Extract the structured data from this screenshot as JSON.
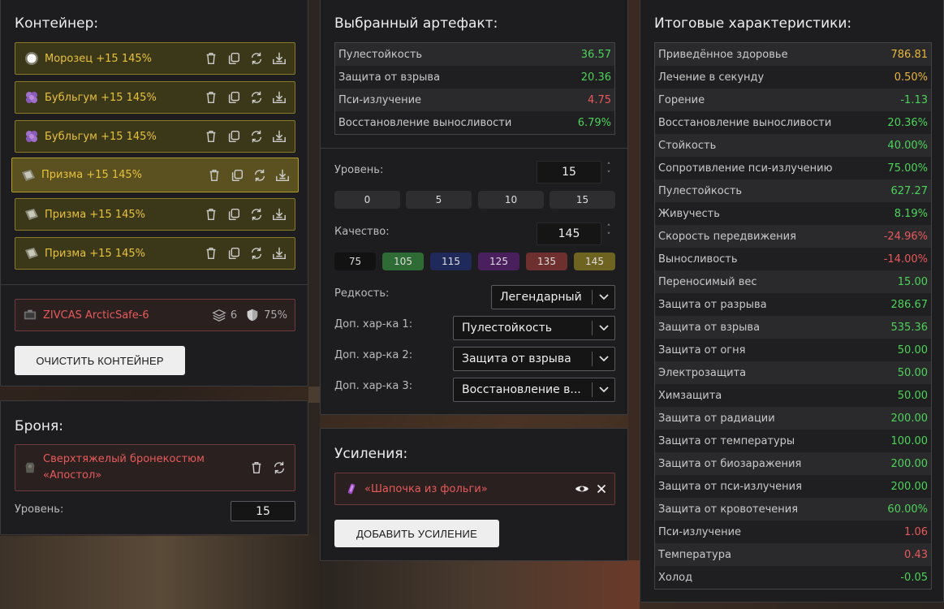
{
  "container": {
    "title": "Контейнер:",
    "items": [
      {
        "label": "Морозец +15 145%",
        "icon": "frost-orb-icon",
        "selected": false
      },
      {
        "label": "Бубльгум +15 145%",
        "icon": "bubblegum-icon",
        "selected": false
      },
      {
        "label": "Бубльгум +15 145%",
        "icon": "bubblegum-icon",
        "selected": false
      },
      {
        "label": "Призма +15 145%",
        "icon": "prism-icon",
        "selected": true
      },
      {
        "label": "Призма +15 145%",
        "icon": "prism-icon",
        "selected": false
      },
      {
        "label": "Призма +15 145%",
        "icon": "prism-icon",
        "selected": false
      }
    ],
    "box": {
      "name": "ZIVCAS ArcticSafe-6",
      "slots": "6",
      "protection": "75%"
    },
    "clear_label": "ОЧИСТИТЬ КОНТЕЙНЕР"
  },
  "armor": {
    "title": "Броня:",
    "name_line1": "Сверхтяжелый бронекостюм",
    "name_line2": "«Апостол»",
    "level_label": "Уровень:",
    "level_value": "15"
  },
  "artifact": {
    "title": "Выбранный артефакт:",
    "stats": [
      {
        "name": "Пулестойкость",
        "value": "36.57",
        "tone": "green"
      },
      {
        "name": "Защита от взрыва",
        "value": "20.36",
        "tone": "green"
      },
      {
        "name": "Пси-излучение",
        "value": "4.75",
        "tone": "red"
      },
      {
        "name": "Восстановление выносливости",
        "value": "6.79%",
        "tone": "green"
      }
    ],
    "level_label": "Уровень:",
    "level_value": "15",
    "level_presets": [
      "0",
      "5",
      "10",
      "15"
    ],
    "quality_label": "Качество:",
    "quality_value": "145",
    "quality_presets": [
      {
        "label": "75",
        "color": "#121212"
      },
      {
        "label": "105",
        "color": "#2f6b34"
      },
      {
        "label": "115",
        "color": "#1f2a5a"
      },
      {
        "label": "125",
        "color": "#4a1f5e"
      },
      {
        "label": "135",
        "color": "#6e2f2f"
      },
      {
        "label": "145",
        "color": "#6e6320"
      }
    ],
    "rarity_label": "Редкость:",
    "rarity_value": "Легендарный",
    "extra1_label": "Доп. хар-ка 1:",
    "extra1_value": "Пулестойкость",
    "extra2_label": "Доп. хар-ка 2:",
    "extra2_value": "Защита от взрыва",
    "extra3_label": "Доп. хар-ка 3:",
    "extra3_value": "Восстановление в..."
  },
  "boosts": {
    "title": "Усиления:",
    "item": "«Шапочка из фольги»",
    "add_label": "ДОБАВИТЬ УСИЛЕНИЕ"
  },
  "totals": {
    "title": "Итоговые характеристики:",
    "rows": [
      {
        "name": "Приведённое здоровье",
        "value": "786.81",
        "tone": "yellow"
      },
      {
        "name": "Лечение в секунду",
        "value": "0.50%",
        "tone": "yellow"
      },
      {
        "name": "Горение",
        "value": "-1.13",
        "tone": "green"
      },
      {
        "name": "Восстановление выносливости",
        "value": "20.36%",
        "tone": "green"
      },
      {
        "name": "Стойкость",
        "value": "40.00%",
        "tone": "green"
      },
      {
        "name": "Сопротивление пси-излучению",
        "value": "75.00%",
        "tone": "green"
      },
      {
        "name": "Пулестойкость",
        "value": "627.27",
        "tone": "green"
      },
      {
        "name": "Живучесть",
        "value": "8.19%",
        "tone": "green"
      },
      {
        "name": "Скорость передвижения",
        "value": "-24.96%",
        "tone": "red"
      },
      {
        "name": "Выносливость",
        "value": "-14.00%",
        "tone": "red"
      },
      {
        "name": "Переносимый вес",
        "value": "15.00",
        "tone": "green"
      },
      {
        "name": "Защита от разрыва",
        "value": "286.67",
        "tone": "green"
      },
      {
        "name": "Защита от взрыва",
        "value": "535.36",
        "tone": "green"
      },
      {
        "name": "Защита от огня",
        "value": "50.00",
        "tone": "green"
      },
      {
        "name": "Электрозащита",
        "value": "50.00",
        "tone": "green"
      },
      {
        "name": "Химзащита",
        "value": "50.00",
        "tone": "green"
      },
      {
        "name": "Защита от радиации",
        "value": "200.00",
        "tone": "green"
      },
      {
        "name": "Защита от температуры",
        "value": "100.00",
        "tone": "green"
      },
      {
        "name": "Защита от биозаражения",
        "value": "200.00",
        "tone": "green"
      },
      {
        "name": "Защита от пси-излучения",
        "value": "200.00",
        "tone": "green"
      },
      {
        "name": "Защита от кровотечения",
        "value": "60.00%",
        "tone": "green"
      },
      {
        "name": "Пси-излучение",
        "value": "1.06",
        "tone": "red"
      },
      {
        "name": "Температура",
        "value": "0.43",
        "tone": "red"
      },
      {
        "name": "Холод",
        "value": "-0.05",
        "tone": "green"
      }
    ]
  }
}
